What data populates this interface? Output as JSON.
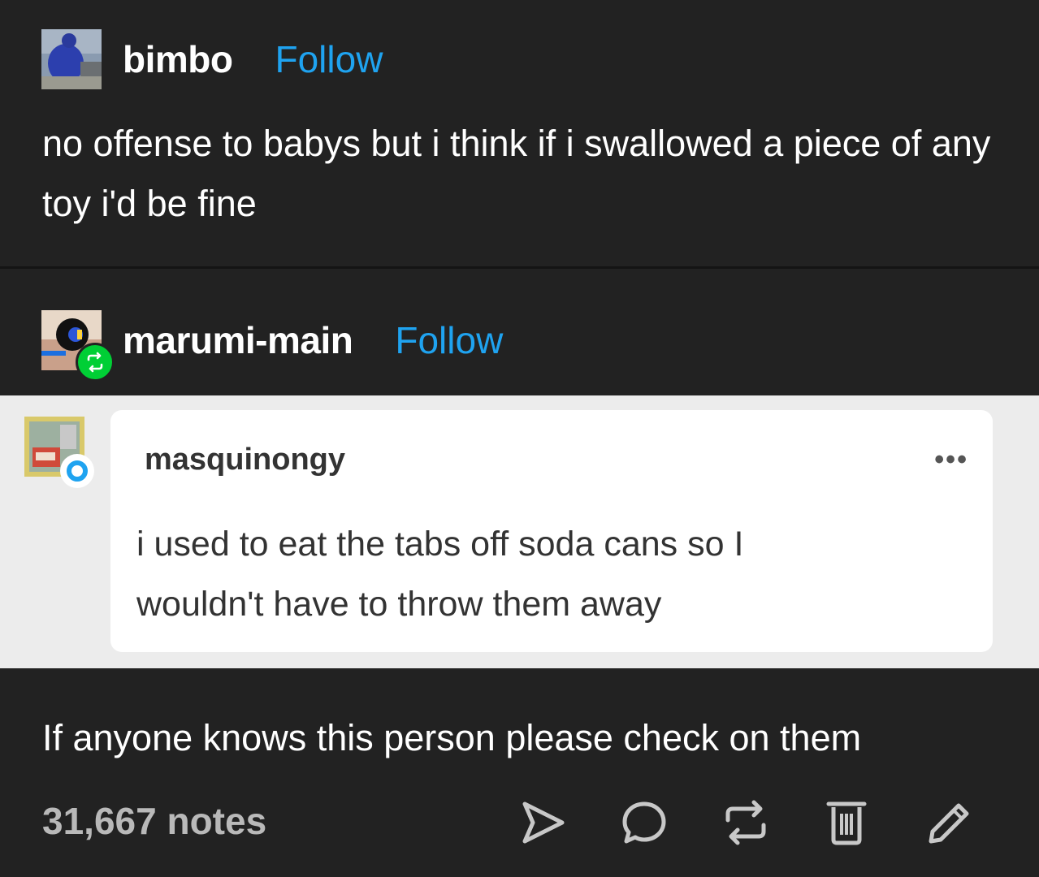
{
  "post": {
    "author": {
      "name": "bimbo",
      "follow_label": "Follow"
    },
    "text": "no offense to babys but i think if i swallowed a piece of any toy i'd be fine",
    "reblogger": {
      "name": "marumi-main",
      "follow_label": "Follow"
    },
    "embedded": {
      "user": "masquinongy",
      "more_label": "•••",
      "text": "i used to eat the tabs off soda cans so I wouldn't have to throw them away"
    },
    "reply_text": "If anyone knows this person please check on them",
    "notes_label": "31,667 notes"
  },
  "icons": [
    "send-icon",
    "comment-icon",
    "reblog-icon",
    "delete-icon",
    "edit-icon"
  ],
  "colors": {
    "background": "#222222",
    "follow": "#1fa3f0",
    "reblog_badge": "#00cf35",
    "embed_bg": "#ececec",
    "notes": "#b9b9b9"
  }
}
